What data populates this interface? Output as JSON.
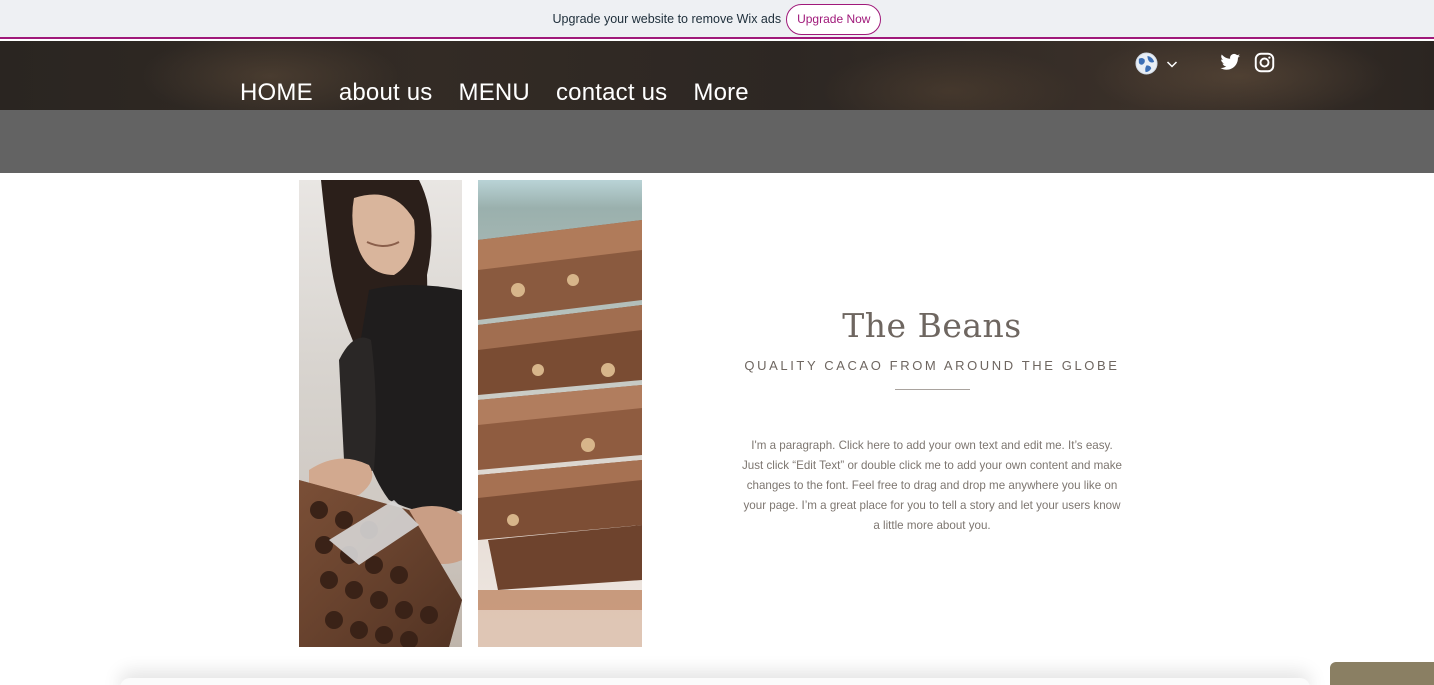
{
  "ad_banner": {
    "text": "Upgrade your website to remove Wix ads",
    "button_label": "Upgrade Now"
  },
  "nav": {
    "items": [
      {
        "label": "HOME"
      },
      {
        "label": "about us"
      },
      {
        "label": "MENU"
      },
      {
        "label": "contact us"
      },
      {
        "label": "More"
      }
    ]
  },
  "header_icons": {
    "language": "globe-icon",
    "language_menu": "chevron-down-icon",
    "social": [
      "twitter-icon",
      "instagram-icon"
    ]
  },
  "section": {
    "title": "The Beans",
    "subtitle": "QUALITY CACAO FROM AROUND THE GLOBE",
    "paragraph": "I'm a paragraph. Click here to add your own text and edit me. It’s easy. Just click “Edit Text” or double click me to add your own content and make changes to the font. Feel free to drag and drop me anywhere you like on your page. I’m a great place for you to tell a story and let your users know a little more about you."
  },
  "colors": {
    "wix_accent": "#a0197a",
    "header_bg": "#2d2723",
    "strip": "#636363",
    "text_muted": "#6e6660",
    "chat_tab": "#8a7f63"
  }
}
